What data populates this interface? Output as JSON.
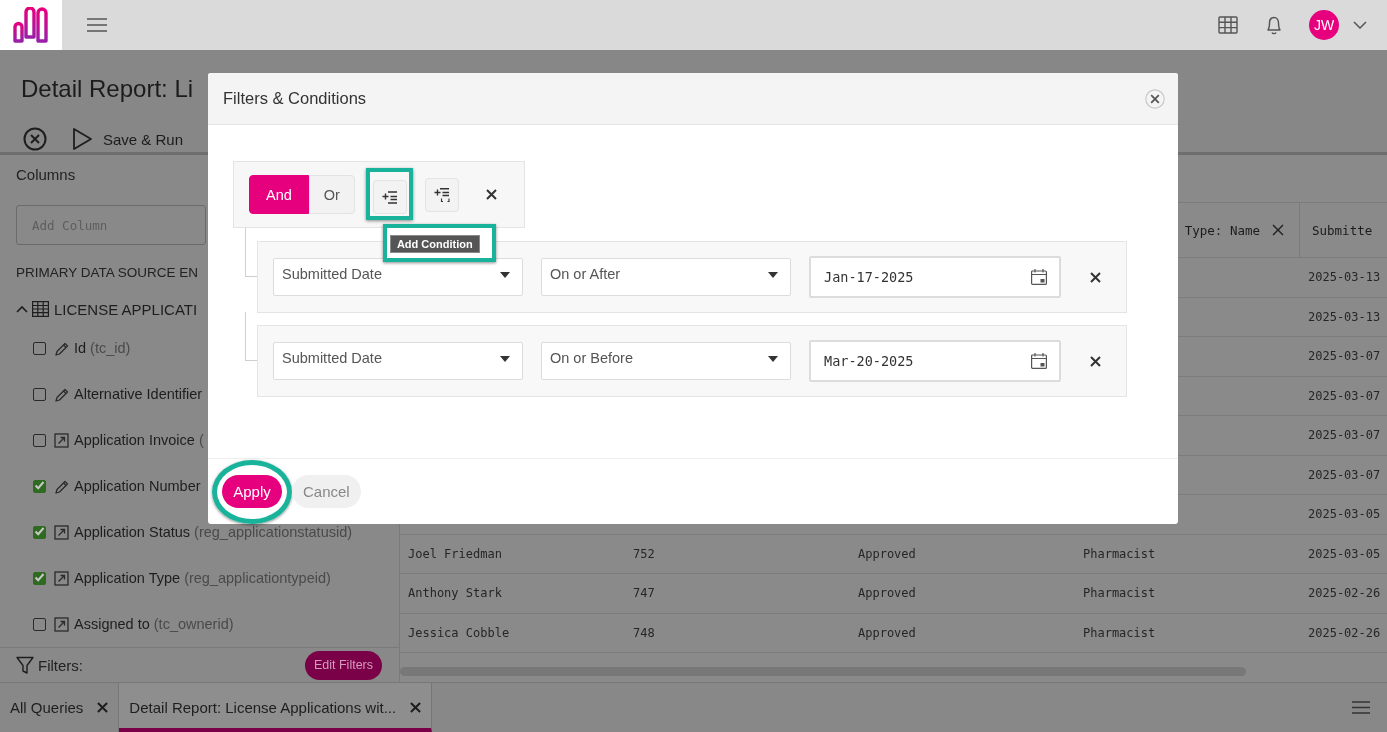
{
  "header": {
    "avatar": "JW"
  },
  "page": {
    "title": "Detail Report: Li",
    "toolbar": [
      {
        "kind": "close"
      },
      {
        "kind": "run",
        "label": "Save & Run"
      }
    ]
  },
  "columns_panel": {
    "title": "Columns",
    "search": {
      "placeholder": "Add Column"
    },
    "section": "PRIMARY DATA SOURCE EN",
    "entity": {
      "label": "LICENSE APPLICATI",
      "expanded": true
    },
    "fields": [
      {
        "kind": "value",
        "label": "Id",
        "field": "(tc_id)",
        "checked": false
      },
      {
        "kind": "value",
        "label": "Alternative Identifier",
        "checked": false
      },
      {
        "kind": "lookup",
        "label": "Application Invoice",
        "field": "(",
        "checked": false
      },
      {
        "kind": "value",
        "label": "Application Number",
        "checked": true
      },
      {
        "kind": "lookup",
        "label": "Application Status",
        "field": "(reg_applicationstatusid)",
        "checked": true
      },
      {
        "kind": "lookup",
        "label": "Application Type",
        "field": "(reg_applicationtypeid)",
        "checked": true
      },
      {
        "kind": "lookup",
        "label": "Assigned to",
        "field": "(tc_ownerid)",
        "checked": false
      }
    ],
    "filters": {
      "label": "Filters:",
      "button": "Edit Filters"
    }
  },
  "table": {
    "columns": [
      {},
      {},
      {},
      {
        "label": "Type: Name",
        "removable": true
      },
      {
        "label": "Submitte",
        "removable": false
      }
    ],
    "rows": [
      {
        "cells": [
          "",
          "",
          "",
          "",
          "2025-03-13"
        ]
      },
      {
        "cells": [
          "",
          "",
          "",
          "",
          "2025-03-13"
        ]
      },
      {
        "cells": [
          "",
          "",
          "",
          "",
          "2025-03-07"
        ]
      },
      {
        "cells": [
          "",
          "",
          "",
          "",
          "2025-03-07"
        ]
      },
      {
        "cells": [
          "",
          "",
          "",
          "",
          "2025-03-07"
        ]
      },
      {
        "cells": [
          "",
          "",
          "",
          "",
          "2025-03-07"
        ]
      },
      {
        "cells": [
          "",
          "",
          "",
          "",
          "2025-03-05"
        ]
      },
      {
        "cells": [
          "Joel Friedman",
          "752",
          "Approved",
          "Pharmacist",
          "2025-03-05"
        ]
      },
      {
        "cells": [
          "Anthony Stark",
          "747",
          "Approved",
          "Pharmacist",
          "2025-02-26"
        ]
      },
      {
        "cells": [
          "Jessica Cobble",
          "748",
          "Approved",
          "Pharmacist",
          "2025-02-26"
        ]
      }
    ]
  },
  "bottom_tabs": [
    {
      "label": "All Queries",
      "selected": false
    },
    {
      "label": "Detail Report: License Applications wit...",
      "selected": true
    }
  ],
  "dialog": {
    "title": "Filters & Conditions",
    "group": {
      "operators": [
        {
          "label": "And",
          "selected": true
        },
        {
          "label": "Or",
          "selected": false
        }
      ],
      "actions": [
        {
          "kind": "add-condition",
          "highlighted": true,
          "tooltip": {
            "text": "Add Condition",
            "highlighted": true
          }
        },
        {
          "kind": "add-group",
          "highlighted": false
        },
        {
          "kind": "remove",
          "highlighted": false
        }
      ]
    },
    "conditions": [
      {
        "field": "Submitted Date",
        "operator": "On or After",
        "value": "Jan-17-2025"
      },
      {
        "field": "Submitted Date",
        "operator": "On or Before",
        "value": "Mar-20-2025"
      }
    ],
    "buttons": [
      {
        "label": "Apply",
        "kind": "primary",
        "highlighted": true
      },
      {
        "label": "Cancel",
        "kind": "secondary",
        "highlighted": false
      }
    ]
  }
}
